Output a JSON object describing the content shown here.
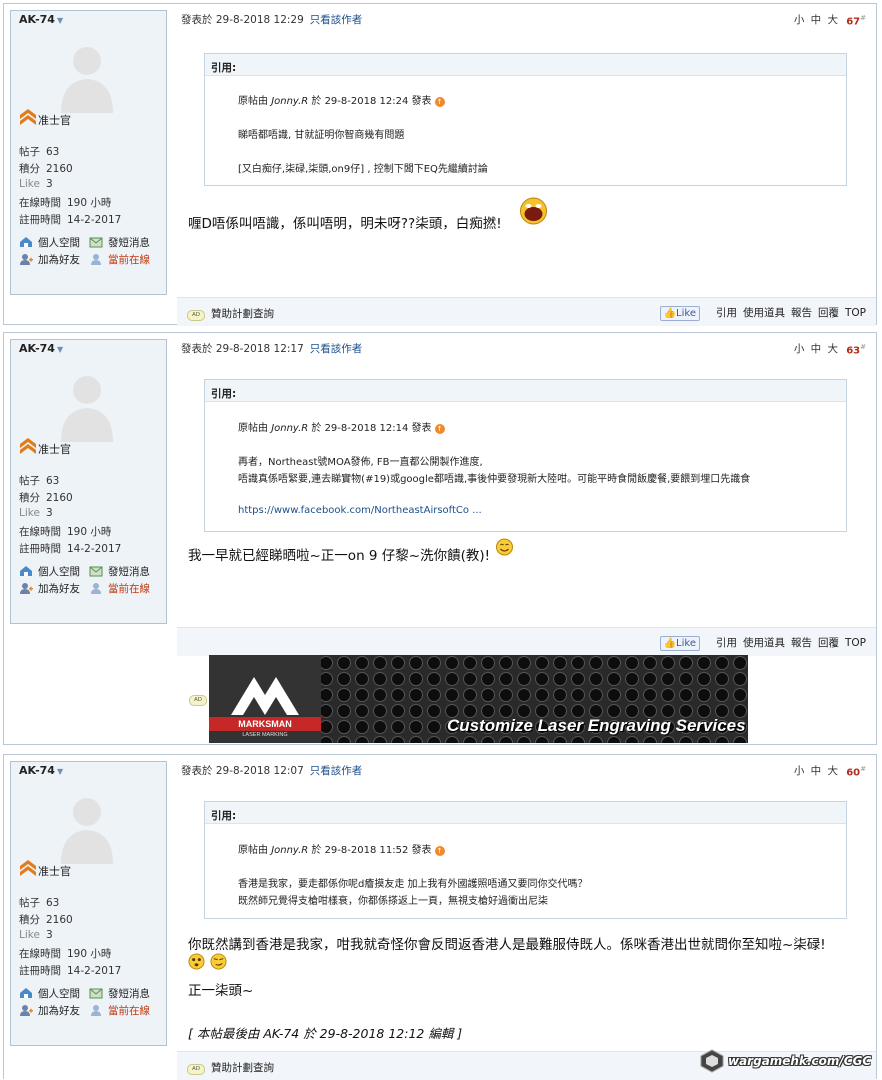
{
  "user": {
    "name": "AK-74",
    "rank": "准士官",
    "posts_label": "帖子",
    "posts": "63",
    "points_label": "積分",
    "points": "2160",
    "like_label": "Like",
    "like": "3",
    "online_label": "在線時間",
    "online": "190 小時",
    "reg_label": "註冊時間",
    "reg": "14-2-2017",
    "links": {
      "space": "個人空間",
      "message": "發短消息",
      "add_friend": "加為好友",
      "online_now": "當前在線"
    }
  },
  "common": {
    "only_author": "只看該作者",
    "sizes": "小 中 大",
    "quote_label": "引用:",
    "sponsor": "贊助計劃查詢",
    "like_btn": "Like",
    "actions": [
      "引用",
      "使用道具",
      "報告",
      "回覆",
      "TOP"
    ]
  },
  "posts": [
    {
      "posted": "發表於 29-8-2018 12:29",
      "floor": "67",
      "quote": {
        "prefix": "原帖由",
        "author": "Jonny.R",
        "suffix": "於 29-8-2018 12:24 發表",
        "lines": [
          "睇唔都唔識, 甘就証明你智商幾有問題",
          "[又白痴仔,柒碌,柒頭,on9仔] , 控制下闆下EQ先繼續討論"
        ]
      },
      "body": [
        "喱D唔係叫唔識，係叫唔明，明未呀??柒頭，白痴撚!"
      ]
    },
    {
      "posted": "發表於 29-8-2018 12:17",
      "floor": "63",
      "quote": {
        "prefix": "原帖由",
        "author": "Jonny.R",
        "suffix": "於 29-8-2018 12:14 發表",
        "lines": [
          "再者，Northeast號MOA發佈, FB一直都公開製作進度,",
          "唔識真係唔緊要,連去睇實物(#19)或google都唔識,事後仲要發現新大陸咁。可能平時食閒飯慶餐,要餵到埋口先識食"
        ],
        "link": "https://www.facebook.com/NortheastAirsoftCo ..."
      },
      "body": [
        "我一早就已經睇晒啦~正一on 9 仔黎~洗你饋(教)!"
      ]
    },
    {
      "posted": "發表於 29-8-2018 12:07",
      "floor": "60",
      "quote": {
        "prefix": "原帖由",
        "author": "Jonny.R",
        "suffix": "於 29-8-2018 11:52 發表",
        "lines": [
          "香港是我家，要走都係你呢d癐摸友走 加上我有外國護照唔通又要同你交代嗎？",
          "既然師兄覺得支槍咁樣衰，你都係搽返上一頁，無視支槍好過衝出尼柒"
        ]
      },
      "body": [
        "你既然講到香港是我家，咁我就奇怪你會反問返香港人是最難服侍既人。係咪香港出世就問你至知啦~柒碌!",
        "正一柒頭~"
      ],
      "edit": "[ 本帖最後由 AK-74 於 29-8-2018 12:12 編輯 ]"
    }
  ],
  "ad": {
    "badge": "AD",
    "brand": "MARKSMAN",
    "brand_sub": "LASER MARKING",
    "tagline": "Customize Laser Engraving Services"
  },
  "watermark": "wargamehk.com/CGC",
  "colors": {
    "floor": "#b02e1c",
    "link": "#1c4f8a",
    "online": "#c03a10",
    "border": "#b9c7d6"
  }
}
